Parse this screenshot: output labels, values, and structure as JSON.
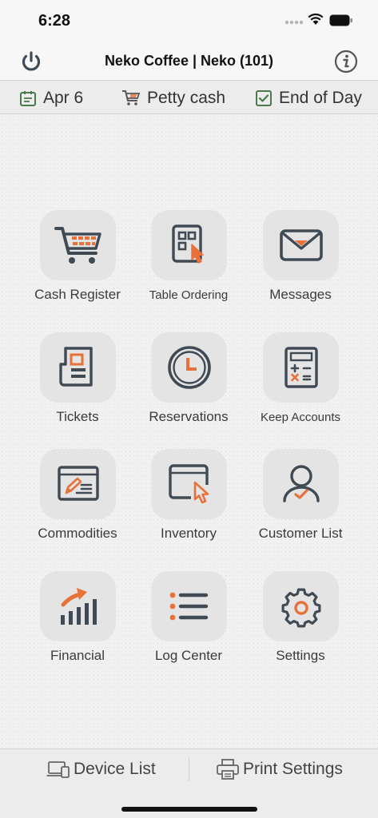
{
  "status_bar": {
    "time": "6:28"
  },
  "header": {
    "title": "Neko Coffee | Neko (101)"
  },
  "info_bar": {
    "date": "Apr 6",
    "petty_cash": "Petty cash",
    "end_of_day": "End of Day"
  },
  "menu": {
    "items": [
      {
        "label": "Cash Register",
        "icon": "cart-icon"
      },
      {
        "label": "Table Ordering",
        "icon": "table-ordering-icon"
      },
      {
        "label": "Messages",
        "icon": "envelope-icon"
      },
      {
        "label": "Tickets",
        "icon": "ticket-icon"
      },
      {
        "label": "Reservations",
        "icon": "clock-icon"
      },
      {
        "label": "Keep Accounts",
        "icon": "calculator-icon"
      },
      {
        "label": "Commodities",
        "icon": "commodity-edit-icon"
      },
      {
        "label": "Inventory",
        "icon": "inventory-window-icon"
      },
      {
        "label": "Customer List",
        "icon": "customer-icon"
      },
      {
        "label": "Financial",
        "icon": "financial-chart-icon"
      },
      {
        "label": "Log Center",
        "icon": "list-icon"
      },
      {
        "label": "Settings",
        "icon": "gear-icon"
      }
    ]
  },
  "bottom_bar": {
    "device_list": "Device List",
    "print_settings": "Print Settings"
  },
  "colors": {
    "accent": "#e8713a",
    "icon_dark": "#3f4a54",
    "check_green": "#4b7a4b"
  }
}
